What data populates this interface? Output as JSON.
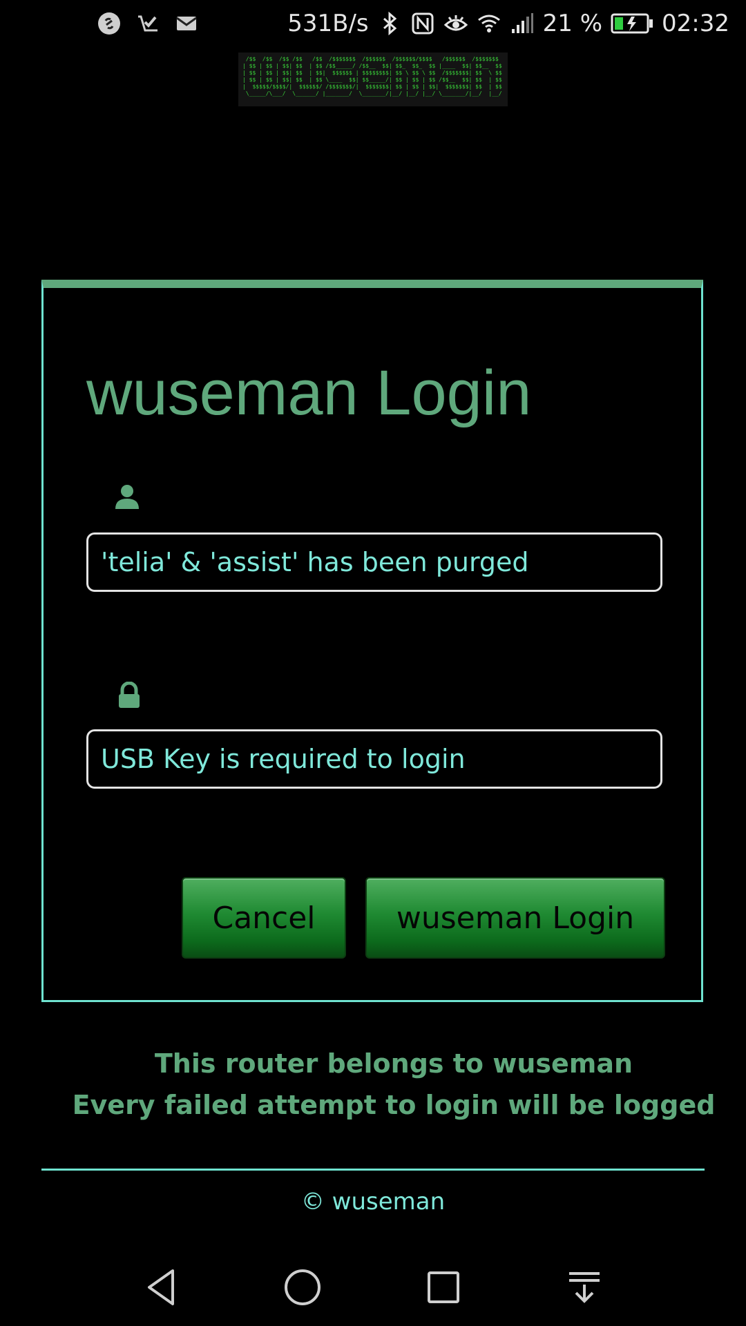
{
  "status_bar": {
    "net_speed": "531B/s",
    "battery_percent": "21 %",
    "time": "02:32",
    "left_icons": [
      "shazam-icon",
      "inbox-check-icon",
      "mail-icon"
    ],
    "right_icons": [
      "bluetooth-icon",
      "nfc-icon",
      "eye-comfort-icon",
      "wifi-icon",
      "signal-icon",
      "battery-charging-icon"
    ]
  },
  "banner": {
    "ascii_art": " /$$  /$$  /$$ /$$   /$$  /$$$$$$$  /$$$$$$  /$$$$$$/$$$$   /$$$$$$  /$$$$$$$\n| $$ | $$ | $$| $$  | $$ /$$_____/ /$$__  $$| $$_  $$_  $$ |____  $$| $$__  $$\n| $$ | $$ | $$| $$  | $$|  $$$$$$ | $$$$$$$$| $$ \\ $$ \\ $$  /$$$$$$$| $$  \\ $$\n| $$ | $$ | $$| $$  | $$ \\____  $$| $$_____/| $$ | $$ | $$ /$$__  $$| $$  | $$\n|  $$$$$/$$$$/|  $$$$$$/ /$$$$$$$/|  $$$$$$$| $$ | $$ | $$|  $$$$$$$| $$  | $$\n \\_____/\\___/  \\______/ |_______/  \\_______/|__/ |__/ |__/ \\_______/|__/  |__/"
  },
  "login": {
    "title": "wuseman Login",
    "username_placeholder": "'telia' & 'assist' has been purged",
    "password_placeholder": "USB Key is required to login",
    "cancel_label": "Cancel",
    "submit_label": "wuseman Login",
    "user_icon": "user-icon",
    "lock_icon": "lock-icon"
  },
  "notice": {
    "line1": "This router belongs to wuseman",
    "line2": "Every failed attempt to login will be logged"
  },
  "footer": {
    "copyright": "© wuseman"
  },
  "navbar": {
    "icons": [
      "back-icon",
      "home-icon",
      "recents-icon",
      "notification-pull-icon"
    ]
  },
  "colors": {
    "accent_green": "#5fa87c",
    "accent_cyan": "#6fe3d0",
    "input_text": "#7fe8da",
    "button_green": "#1f8a32",
    "background": "#000000"
  }
}
